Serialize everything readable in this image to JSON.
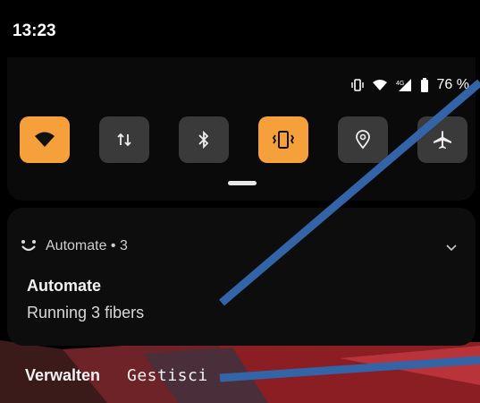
{
  "status_bar": {
    "time": "13:23",
    "battery_percent": "76 %",
    "icons": [
      "vibrate-icon",
      "wifi-icon",
      "signal-4g-icon",
      "battery-icon"
    ]
  },
  "quick_settings": {
    "tiles": [
      {
        "name": "wifi-tile",
        "icon": "wifi-icon",
        "active": true
      },
      {
        "name": "mobile-data-tile",
        "icon": "data-arrows-icon",
        "active": false
      },
      {
        "name": "bluetooth-tile",
        "icon": "bluetooth-icon",
        "active": false
      },
      {
        "name": "vibrate-tile",
        "icon": "vibrate-icon",
        "active": true
      },
      {
        "name": "location-tile",
        "icon": "location-icon",
        "active": false
      },
      {
        "name": "airplane-tile",
        "icon": "airplane-icon",
        "active": false
      }
    ],
    "active_color": "#f6a03c",
    "inactive_color": "#3a3a3a"
  },
  "notification": {
    "app_name": "Automate • 3",
    "title": "Automate",
    "text": "Running 3 fibers"
  },
  "footer": {
    "manage_label": "Verwalten",
    "manage_label_alt": "Gestisci"
  }
}
